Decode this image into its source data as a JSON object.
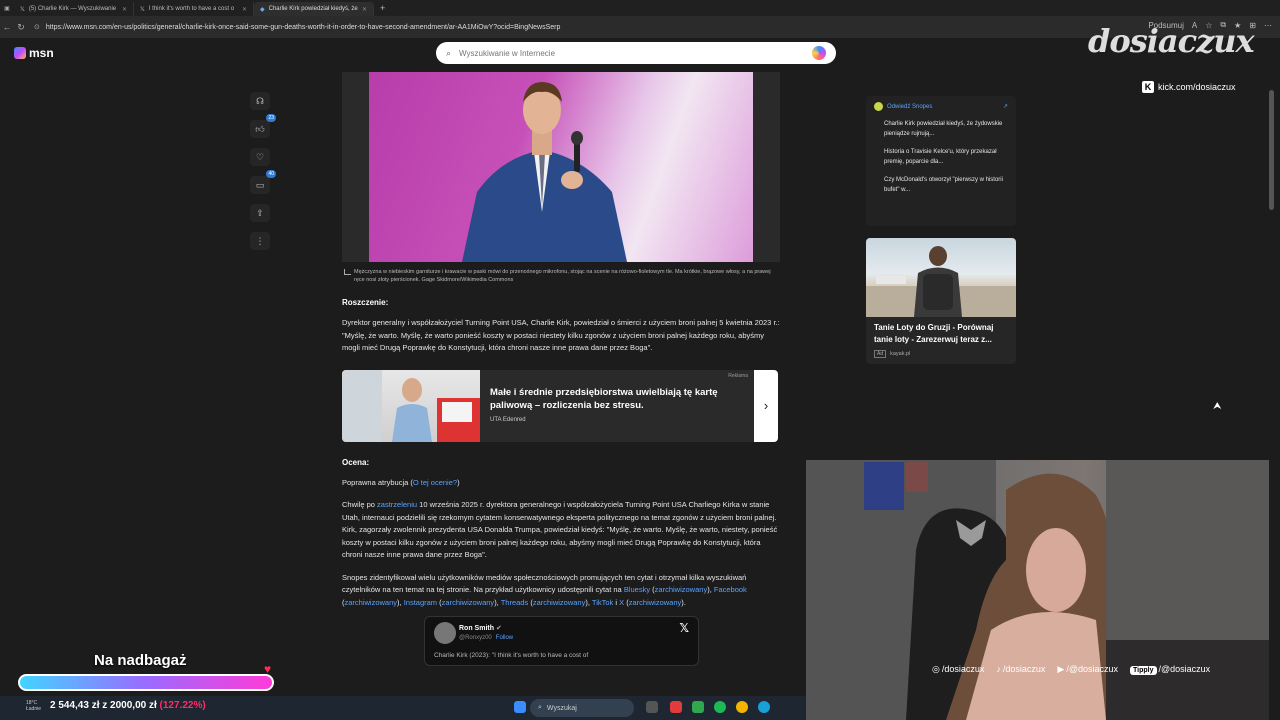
{
  "tabs": [
    {
      "icon": "x-logo-icon",
      "label": "(5) Charlie Kirk — Wyszukiwanie"
    },
    {
      "icon": "x-logo-icon",
      "label": "I think it's worth to have a cost o"
    },
    {
      "icon": "msn-logo-icon",
      "label": "Charlie Kirk powiedział kiedyś, że"
    }
  ],
  "address": {
    "url": "https://www.msn.com/en-us/politics/general/charlie-kirk-once-said-some-gun-deaths-worth-it-in-order-to-have-second-amendment/ar-AA1MiOwY?ocid=BingNewsSerp",
    "summarize_label": "Podsumuj"
  },
  "header": {
    "logo": "msn",
    "search_placeholder": "Wyszukiwanie w Internecie"
  },
  "rail": {
    "like_count": "23",
    "comment_count": "40"
  },
  "article": {
    "caption": "Mężczyzna w niebieskim garniturze i krawacie w paski mówi do przenośnego mikrofonu, stojąc na scenie na różowo-fioletowym tle. Ma krótkie, brązowe włosy, a na prawej ręce nosi złoty pierścionek. Gage Skidmore/Wikimedia Commons",
    "claim_heading": "Roszczenie:",
    "claim_text": "Dyrektor generalny i współzałożyciel Turning Point USA, Charlie Kirk, powiedział o śmierci z użyciem broni palnej 5 kwietnia 2023 r.: \"Myślę, że warto. Myślę, że warto ponieść koszty w postaci niestety kilku zgonów z użyciem broni palnej każdego roku, abyśmy mogli mieć Drugą Poprawkę do Konstytucji, która chroni nasze inne prawa dane przez Boga\".",
    "ad": {
      "tag": "Reklama",
      "title": "Małe i średnie przedsiębiorstwa uwielbiają tę kartę paliwową – rozliczenia bez stresu.",
      "brand": "UTA Edenred"
    },
    "rating_heading": "Ocena:",
    "rating_prefix": "Poprawna atrybucja (",
    "rating_link": "O tej ocenie?",
    "rating_suffix": ")",
    "p1_before": "Chwilę po ",
    "p1_link": "zastrzeleniu",
    "p1_after": " 10 września 2025 r. dyrektora generalnego i współzałożyciela Turning Point USA Charliego Kirka w stanie Utah, internauci podzielili się rzekomym cytatem konserwatywnego eksperta politycznego na temat zgonów z użyciem broni palnej. Kirk, zagorzały zwolennik prezydenta USA Donalda Trumpa, powiedział kiedyś: \"Myślę, że warto. Myślę, że warto, niestety, ponieść koszty w postaci kilku zgonów z użyciem broni palnej każdego roku, abyśmy mogli mieć Drugą Poprawkę do Konstytucji, która chroni nasze inne prawa dane przez Boga\".",
    "p2_text": "Snopes zidentyfikował wielu użytkowników mediów społecznościowych promujących ten cytat i otrzymał kilka wyszukiwań czytelników na ten temat na tej stronie. Na przykład użytkownicy udostępnili cytat na ",
    "p2_links": [
      "Bluesky",
      "zarchiwizowany",
      "Facebook",
      "zarchiwizowany",
      "Instagram",
      "zarchiwizowany",
      "Threads",
      "zarchiwizowany",
      "TikTok",
      "X",
      "zarchiwizowany"
    ],
    "tweet": {
      "name": "Ron Smith",
      "handle": "@Ronxyz00",
      "follow": "Follow",
      "text": "Charlie Kirk (2023): \"I think it's worth to have a cost of"
    }
  },
  "sidebar": {
    "snopes_label": "Odwiedź Snopes",
    "items": [
      "Charlie Kirk powiedział kiedyś, że żydowskie pieniądze rujnują...",
      "Historia o Travisie Kelce'u, który przekazał premię, poparcie dla...",
      "Czy McDonald's otworzył \"pierwszy w historii bufet\" w..."
    ],
    "ad_title": "Tanie Loty do Gruzji - Porównaj tanie loty - Zarezerwuj teraz z...",
    "ad_badge": "Ad",
    "ad_source": "kayak.pl"
  },
  "stream": {
    "watermark": "dosiaczux",
    "kick_url": "kick.com/dosiaczux",
    "socials": [
      "/dosiaczux",
      "/dosiaczux",
      "/@dosiaczux",
      "/@dosiaczux"
    ],
    "tipply": "Tipply",
    "goal_title": "Na nadbagaż",
    "goal_amount": "2 544,43 zł z 2000,00 zł",
    "goal_percent": "(127.22%)",
    "goal_progress": 1.0
  },
  "taskbar": {
    "weather_temp": "18°C",
    "weather_desc": "Ładnie",
    "search_label": "Wyszukaj"
  }
}
